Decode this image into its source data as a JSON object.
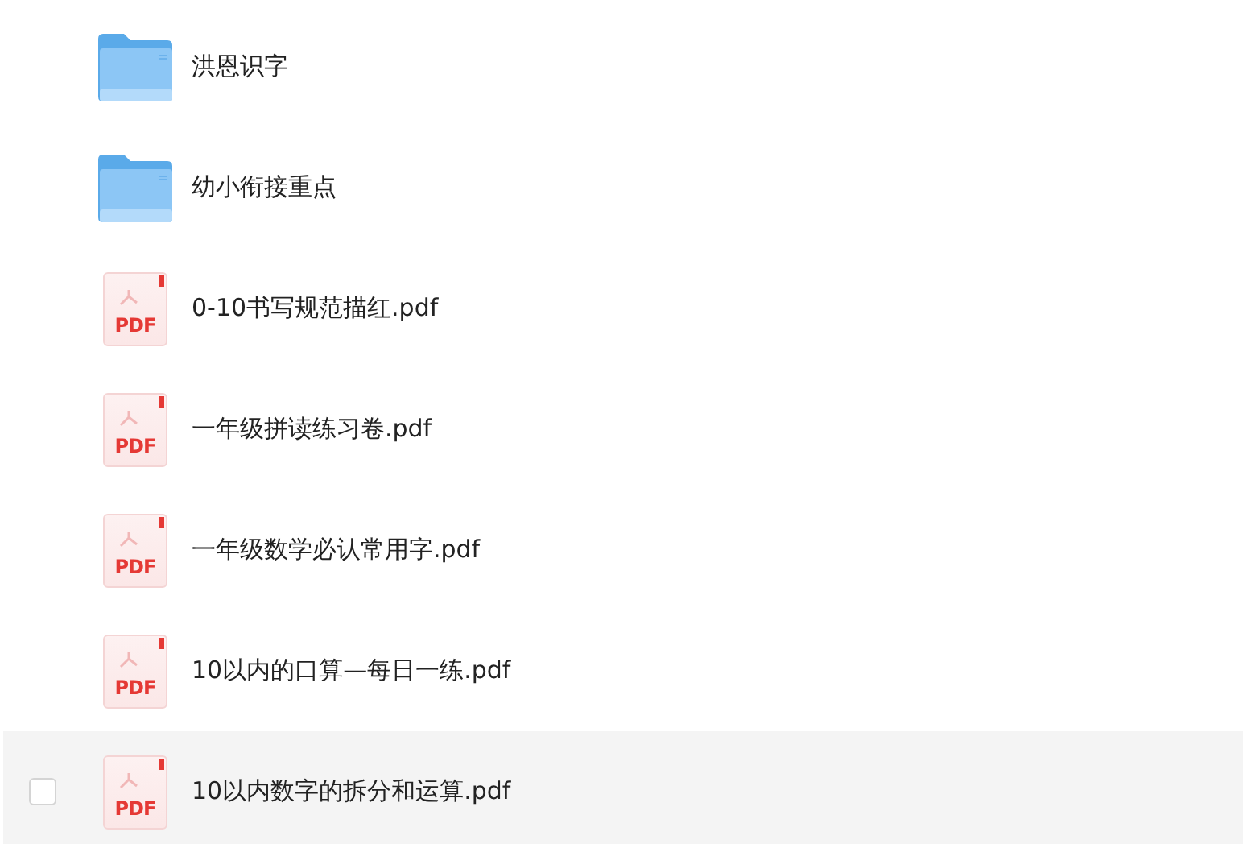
{
  "files": [
    {
      "kind": "folder",
      "name": "洪恩识字",
      "hovered": false,
      "checked": false
    },
    {
      "kind": "folder",
      "name": "幼小衔接重点",
      "hovered": false,
      "checked": false
    },
    {
      "kind": "pdf",
      "name": "0-10书写规范描红.pdf",
      "badge": "PDF",
      "hovered": false,
      "checked": false
    },
    {
      "kind": "pdf",
      "name": "一年级拼读练习卷.pdf",
      "badge": "PDF",
      "hovered": false,
      "checked": false
    },
    {
      "kind": "pdf",
      "name": "一年级数学必认常用字.pdf",
      "badge": "PDF",
      "hovered": false,
      "checked": false
    },
    {
      "kind": "pdf",
      "name": "10以内的口算—每日一练.pdf",
      "badge": "PDF",
      "hovered": false,
      "checked": false
    },
    {
      "kind": "pdf",
      "name": "10以内数字的拆分和运算.pdf",
      "badge": "PDF",
      "hovered": true,
      "checked": false
    }
  ]
}
